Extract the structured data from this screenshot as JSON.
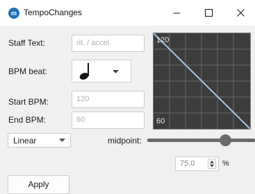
{
  "window": {
    "title": "TempoChanges",
    "icon": "musescore-app-icon",
    "controls": [
      "minimize-icon",
      "maximize-icon",
      "close-icon"
    ]
  },
  "form": {
    "staff_text_label": "Staff Text:",
    "staff_text_placeholder": "rit. / accel.",
    "bpm_beat_label": "BPM beat:",
    "bpm_beat_value": "quarter-note-icon",
    "start_bpm_label": "Start BPM:",
    "start_bpm_placeholder": "120",
    "end_bpm_label": "End BPM:",
    "end_bpm_placeholder": "60"
  },
  "preview": {
    "start_label": "120",
    "end_label": "60"
  },
  "curve": {
    "mode": "Linear",
    "midpoint_label": "midpoint:",
    "midpoint_slider_fraction": 0.78,
    "midpoint_value": "75,0",
    "midpoint_unit": "%"
  },
  "actions": {
    "apply_label": "Apply"
  },
  "colors": {
    "accent": "#1e6fb8",
    "preview_bg": "#3c3c3c",
    "preview_line": "#a8c8e8"
  }
}
